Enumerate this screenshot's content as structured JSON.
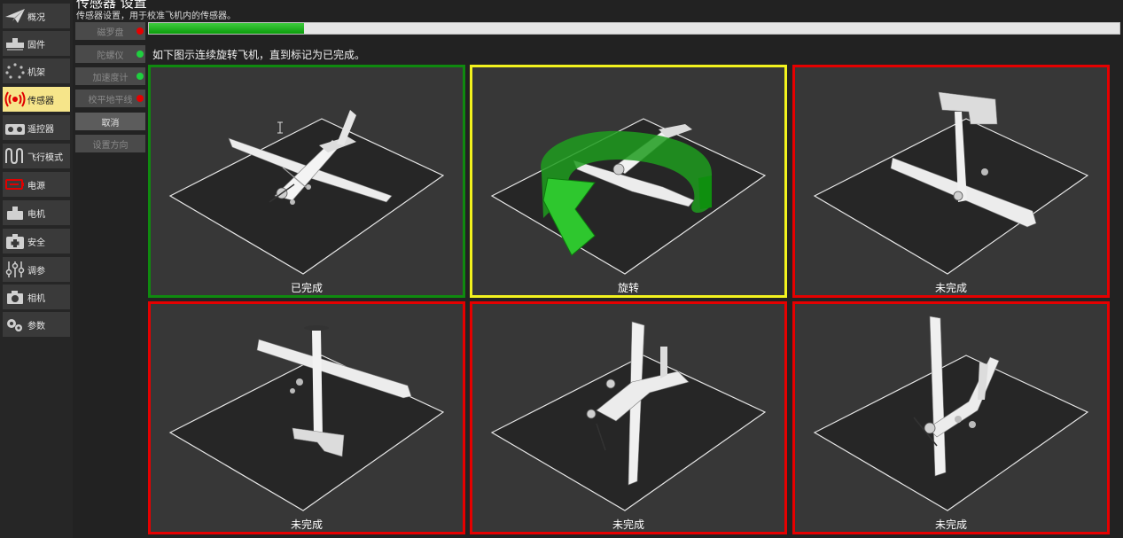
{
  "nav": {
    "items": [
      {
        "label": "概况",
        "icon": "paper-plane-icon"
      },
      {
        "label": "固件",
        "icon": "firmware-chip-icon"
      },
      {
        "label": "机架",
        "icon": "airframe-dots-icon"
      },
      {
        "label": "传感器",
        "icon": "sensor-wave-icon"
      },
      {
        "label": "遥控器",
        "icon": "remote-controller-icon"
      },
      {
        "label": "飞行模式",
        "icon": "flight-mode-wave-icon"
      },
      {
        "label": "电源",
        "icon": "battery-icon"
      },
      {
        "label": "电机",
        "icon": "motor-icon"
      },
      {
        "label": "安全",
        "icon": "first-aid-kit-icon"
      },
      {
        "label": "调参",
        "icon": "tuning-sliders-icon"
      },
      {
        "label": "相机",
        "icon": "camera-icon"
      },
      {
        "label": "参数",
        "icon": "gears-icon"
      }
    ]
  },
  "header": {
    "title": "传感器 设置",
    "subtitle": "传感器设置，用于校准飞机内的传感器。"
  },
  "sensors": {
    "buttons": [
      {
        "label": "磁罗盘",
        "status_color": "#e50000"
      },
      {
        "label": "陀螺仪",
        "status_color": "#1fcf3f"
      },
      {
        "label": "加速度计",
        "status_color": "#1fcf3f"
      },
      {
        "label": "校平地平线",
        "status_color": "#e50000"
      }
    ],
    "cancel_label": "取消",
    "set_orientation_label": "设置方向"
  },
  "progress": {
    "value": 0.16
  },
  "instruction": "如下图示连续旋转飞机，直到标记为已完成。",
  "orientations": [
    {
      "status": "已完成",
      "border_color": "#0f8a0f"
    },
    {
      "status": "旋转",
      "border_color": "#f2f21e"
    },
    {
      "status": "未完成",
      "border_color": "#e50000"
    },
    {
      "status": "未完成",
      "border_color": "#e50000"
    },
    {
      "status": "未完成",
      "border_color": "#e50000"
    },
    {
      "status": "未完成",
      "border_color": "#e50000"
    }
  ]
}
